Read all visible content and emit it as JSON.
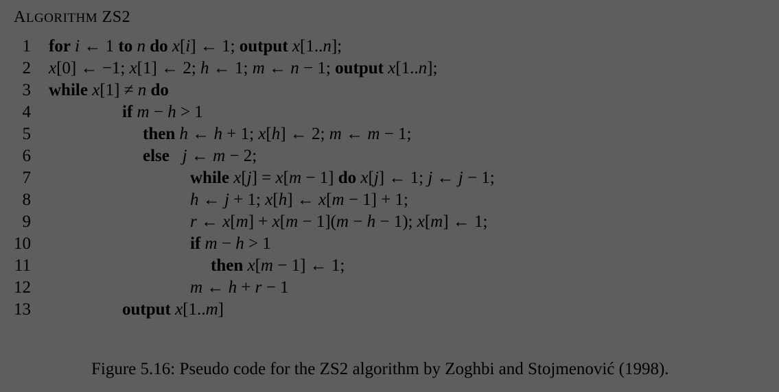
{
  "algorithm": {
    "title_first": "A",
    "title_rest": "LGORITHM",
    "title_name": "ZS2"
  },
  "lines": [
    {
      "n": "1",
      "indent": 0,
      "segs": [
        {
          "k": "kw",
          "t": "for"
        },
        {
          "k": "t",
          "t": " "
        },
        {
          "k": "m",
          "t": "i"
        },
        {
          "k": "t",
          "t": " ← 1 "
        },
        {
          "k": "kw",
          "t": "to"
        },
        {
          "k": "t",
          "t": " "
        },
        {
          "k": "m",
          "t": "n"
        },
        {
          "k": "t",
          "t": " "
        },
        {
          "k": "kw",
          "t": "do"
        },
        {
          "k": "t",
          "t": " "
        },
        {
          "k": "m",
          "t": "x"
        },
        {
          "k": "t",
          "t": "["
        },
        {
          "k": "m",
          "t": "i"
        },
        {
          "k": "t",
          "t": "] ← 1; "
        },
        {
          "k": "kw",
          "t": "output"
        },
        {
          "k": "t",
          "t": " "
        },
        {
          "k": "m",
          "t": "x"
        },
        {
          "k": "t",
          "t": "[1.."
        },
        {
          "k": "m",
          "t": "n"
        },
        {
          "k": "t",
          "t": "];"
        }
      ]
    },
    {
      "n": "2",
      "indent": 0,
      "segs": [
        {
          "k": "m",
          "t": "x"
        },
        {
          "k": "t",
          "t": "[0] ← −1; "
        },
        {
          "k": "m",
          "t": "x"
        },
        {
          "k": "t",
          "t": "[1] ← 2; "
        },
        {
          "k": "m",
          "t": "h"
        },
        {
          "k": "t",
          "t": " ← 1; "
        },
        {
          "k": "m",
          "t": "m"
        },
        {
          "k": "t",
          "t": " ← "
        },
        {
          "k": "m",
          "t": "n"
        },
        {
          "k": "t",
          "t": " − 1; "
        },
        {
          "k": "kw",
          "t": "output"
        },
        {
          "k": "t",
          "t": " "
        },
        {
          "k": "m",
          "t": "x"
        },
        {
          "k": "t",
          "t": "[1.."
        },
        {
          "k": "m",
          "t": "n"
        },
        {
          "k": "t",
          "t": "];"
        }
      ]
    },
    {
      "n": "3",
      "indent": 0,
      "segs": [
        {
          "k": "kw",
          "t": "while"
        },
        {
          "k": "t",
          "t": " "
        },
        {
          "k": "m",
          "t": "x"
        },
        {
          "k": "t",
          "t": "[1] ≠ "
        },
        {
          "k": "m",
          "t": "n"
        },
        {
          "k": "t",
          "t": " "
        },
        {
          "k": "kw",
          "t": "do"
        }
      ]
    },
    {
      "n": "4",
      "indent": 1,
      "segs": [
        {
          "k": "kw",
          "t": "if"
        },
        {
          "k": "t",
          "t": " "
        },
        {
          "k": "m",
          "t": "m"
        },
        {
          "k": "t",
          "t": " − "
        },
        {
          "k": "m",
          "t": "h"
        },
        {
          "k": "t",
          "t": " > 1"
        }
      ]
    },
    {
      "n": "5",
      "indent": 2,
      "segs": [
        {
          "k": "kw",
          "t": "then"
        },
        {
          "k": "t",
          "t": " "
        },
        {
          "k": "m",
          "t": "h"
        },
        {
          "k": "t",
          "t": " ← "
        },
        {
          "k": "m",
          "t": "h"
        },
        {
          "k": "t",
          "t": " + 1; "
        },
        {
          "k": "m",
          "t": "x"
        },
        {
          "k": "t",
          "t": "["
        },
        {
          "k": "m",
          "t": "h"
        },
        {
          "k": "t",
          "t": "] ← 2; "
        },
        {
          "k": "m",
          "t": "m"
        },
        {
          "k": "t",
          "t": " ← "
        },
        {
          "k": "m",
          "t": "m"
        },
        {
          "k": "t",
          "t": " − 1;"
        }
      ]
    },
    {
      "n": "6",
      "indent": 2,
      "segs": [
        {
          "k": "kw",
          "t": "else"
        },
        {
          "k": "t",
          "t": "   "
        },
        {
          "k": "m",
          "t": "j"
        },
        {
          "k": "t",
          "t": " ← "
        },
        {
          "k": "m",
          "t": "m"
        },
        {
          "k": "t",
          "t": " − 2;"
        }
      ]
    },
    {
      "n": "7",
      "indent": 3,
      "segs": [
        {
          "k": "kw",
          "t": "while"
        },
        {
          "k": "t",
          "t": " "
        },
        {
          "k": "m",
          "t": "x"
        },
        {
          "k": "t",
          "t": "["
        },
        {
          "k": "m",
          "t": "j"
        },
        {
          "k": "t",
          "t": "] = "
        },
        {
          "k": "m",
          "t": "x"
        },
        {
          "k": "t",
          "t": "["
        },
        {
          "k": "m",
          "t": "m"
        },
        {
          "k": "t",
          "t": " − 1] "
        },
        {
          "k": "kw",
          "t": "do"
        },
        {
          "k": "t",
          "t": " "
        },
        {
          "k": "m",
          "t": "x"
        },
        {
          "k": "t",
          "t": "["
        },
        {
          "k": "m",
          "t": "j"
        },
        {
          "k": "t",
          "t": "] ← 1; "
        },
        {
          "k": "m",
          "t": "j"
        },
        {
          "k": "t",
          "t": " ← "
        },
        {
          "k": "m",
          "t": "j"
        },
        {
          "k": "t",
          "t": " − 1;"
        }
      ]
    },
    {
      "n": "8",
      "indent": 3,
      "segs": [
        {
          "k": "m",
          "t": "h"
        },
        {
          "k": "t",
          "t": " ← "
        },
        {
          "k": "m",
          "t": "j"
        },
        {
          "k": "t",
          "t": " + 1; "
        },
        {
          "k": "m",
          "t": "x"
        },
        {
          "k": "t",
          "t": "["
        },
        {
          "k": "m",
          "t": "h"
        },
        {
          "k": "t",
          "t": "] ← "
        },
        {
          "k": "m",
          "t": "x"
        },
        {
          "k": "t",
          "t": "["
        },
        {
          "k": "m",
          "t": "m"
        },
        {
          "k": "t",
          "t": " − 1] + 1;"
        }
      ]
    },
    {
      "n": "9",
      "indent": 3,
      "segs": [
        {
          "k": "m",
          "t": "r"
        },
        {
          "k": "t",
          "t": " ← "
        },
        {
          "k": "m",
          "t": "x"
        },
        {
          "k": "t",
          "t": "["
        },
        {
          "k": "m",
          "t": "m"
        },
        {
          "k": "t",
          "t": "] + "
        },
        {
          "k": "m",
          "t": "x"
        },
        {
          "k": "t",
          "t": "["
        },
        {
          "k": "m",
          "t": "m"
        },
        {
          "k": "t",
          "t": " − 1]("
        },
        {
          "k": "m",
          "t": "m"
        },
        {
          "k": "t",
          "t": " − "
        },
        {
          "k": "m",
          "t": "h"
        },
        {
          "k": "t",
          "t": " − 1); "
        },
        {
          "k": "m",
          "t": "x"
        },
        {
          "k": "t",
          "t": "["
        },
        {
          "k": "m",
          "t": "m"
        },
        {
          "k": "t",
          "t": "] ← 1;"
        }
      ]
    },
    {
      "n": "10",
      "indent": 3,
      "segs": [
        {
          "k": "kw",
          "t": "if"
        },
        {
          "k": "t",
          "t": " "
        },
        {
          "k": "m",
          "t": "m"
        },
        {
          "k": "t",
          "t": " − "
        },
        {
          "k": "m",
          "t": "h"
        },
        {
          "k": "t",
          "t": " > 1"
        }
      ]
    },
    {
      "n": "11",
      "indent": 4,
      "segs": [
        {
          "k": "kw",
          "t": "then"
        },
        {
          "k": "t",
          "t": " "
        },
        {
          "k": "m",
          "t": "x"
        },
        {
          "k": "t",
          "t": "["
        },
        {
          "k": "m",
          "t": "m"
        },
        {
          "k": "t",
          "t": " − 1] ← 1;"
        }
      ]
    },
    {
      "n": "12",
      "indent": 3,
      "segs": [
        {
          "k": "m",
          "t": "m"
        },
        {
          "k": "t",
          "t": " ← "
        },
        {
          "k": "m",
          "t": "h"
        },
        {
          "k": "t",
          "t": " + "
        },
        {
          "k": "m",
          "t": "r"
        },
        {
          "k": "t",
          "t": " − 1"
        }
      ]
    },
    {
      "n": "13",
      "indent": 1,
      "segs": [
        {
          "k": "kw",
          "t": "output"
        },
        {
          "k": "t",
          "t": " "
        },
        {
          "k": "m",
          "t": "x"
        },
        {
          "k": "t",
          "t": "[1.."
        },
        {
          "k": "m",
          "t": "m"
        },
        {
          "k": "t",
          "t": "]"
        }
      ]
    }
  ],
  "caption": "Figure 5.16: Pseudo code for the ZS2 algorithm by Zoghbi and Stojmenović (1998)."
}
